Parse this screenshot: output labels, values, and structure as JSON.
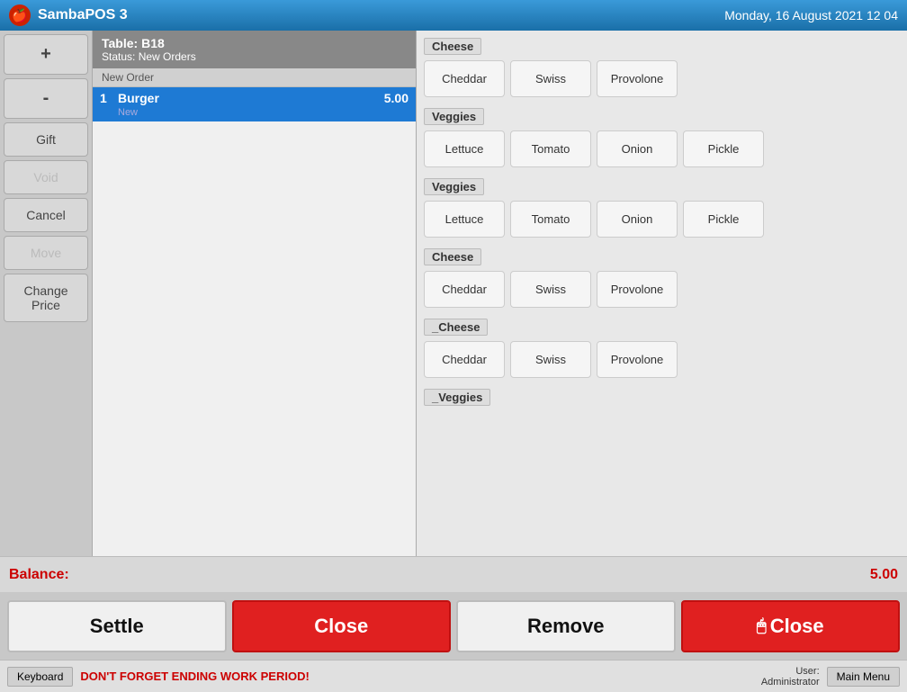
{
  "titlebar": {
    "app_name": "SambaPOS 3",
    "datetime": "Monday, 16 August 2021 12 04"
  },
  "table_info": {
    "table": "Table: B18",
    "status": "Status: New Orders"
  },
  "order_group": {
    "header": "New Order"
  },
  "order_items": [
    {
      "qty": "1",
      "name": "Burger",
      "price": "5.00",
      "status": "New",
      "selected": true
    }
  ],
  "sidebar_buttons": [
    {
      "label": "+",
      "id": "plus",
      "disabled": false
    },
    {
      "label": "-",
      "id": "minus",
      "disabled": false
    },
    {
      "label": "Gift",
      "id": "gift",
      "disabled": false
    },
    {
      "label": "Void",
      "id": "void",
      "disabled": false
    },
    {
      "label": "Cancel",
      "id": "cancel",
      "disabled": false
    },
    {
      "label": "Move",
      "id": "move",
      "disabled": false
    },
    {
      "label": "Change\nPrice",
      "id": "change-price",
      "disabled": false
    }
  ],
  "modifier_groups": [
    {
      "id": "cheese1",
      "header": "Cheese",
      "buttons": [
        "Cheddar",
        "Swiss",
        "Provolone"
      ]
    },
    {
      "id": "veggies1",
      "header": "Veggies",
      "buttons": [
        "Lettuce",
        "Tomato",
        "Onion",
        "Pickle"
      ]
    },
    {
      "id": "veggies2",
      "header": "Veggies",
      "buttons": [
        "Lettuce",
        "Tomato",
        "Onion",
        "Pickle"
      ]
    },
    {
      "id": "cheese2",
      "header": "Cheese",
      "buttons": [
        "Cheddar",
        "Swiss",
        "Provolone"
      ]
    },
    {
      "id": "cheese3",
      "header": "_Cheese",
      "buttons": [
        "Cheddar",
        "Swiss",
        "Provolone"
      ]
    },
    {
      "id": "veggies3",
      "header": "_Veggies",
      "buttons": []
    }
  ],
  "balance": {
    "label": "Balance:",
    "amount": "5.00"
  },
  "action_buttons": {
    "settle": "Settle",
    "close_left": "Close",
    "remove": "Remove",
    "close_right": "Close"
  },
  "statusbar": {
    "keyboard_btn": "Keyboard",
    "warning": "DON'T FORGET ENDING WORK PERIOD!",
    "user_label": "User:",
    "user_name": "Administrator",
    "mainmenu_btn": "Main Menu"
  }
}
